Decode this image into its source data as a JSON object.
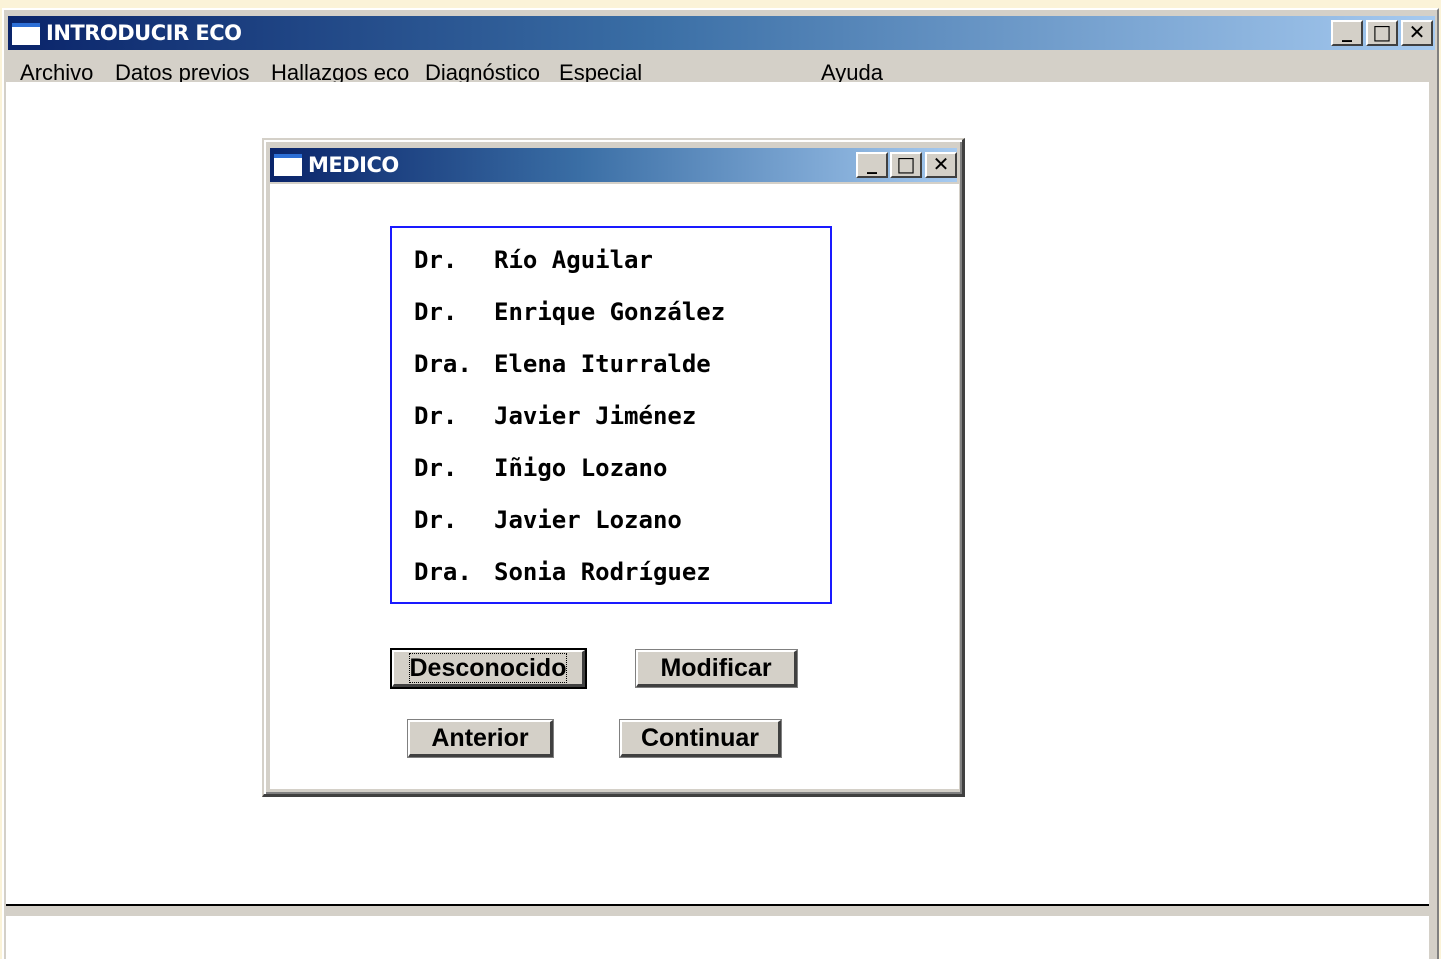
{
  "main_window": {
    "title": "INTRODUCIR ECO",
    "controls": {
      "minimize": "_",
      "maximize": "□",
      "close": "✕"
    }
  },
  "menu": {
    "items": [
      {
        "pre": "",
        "accel": "A",
        "post": "rchivo"
      },
      {
        "pre": "Datos ",
        "accel": "p",
        "post": "revios"
      },
      {
        "pre": "",
        "accel": "H",
        "post": "allazgos eco"
      },
      {
        "pre": "",
        "accel": "D",
        "post": "iagnóstico"
      },
      {
        "pre": "",
        "accel": "E",
        "post": "special"
      },
      {
        "pre": "Ay",
        "accel": "u",
        "post": "da"
      }
    ]
  },
  "dialog": {
    "title": "MEDICO",
    "controls": {
      "minimize": "_",
      "maximize": "□",
      "close": "✕"
    },
    "doctors": [
      {
        "title": "Dr.",
        "name": "Río Aguilar"
      },
      {
        "title": "Dr.",
        "name": "Enrique González"
      },
      {
        "title": "Dra.",
        "name": "Elena Iturralde"
      },
      {
        "title": "Dr.",
        "name": "Javier Jiménez"
      },
      {
        "title": "Dr.",
        "name": "Iñigo Lozano"
      },
      {
        "title": "Dr.",
        "name": "Javier Lozano"
      },
      {
        "title": "Dra.",
        "name": "Sonia Rodríguez"
      }
    ],
    "buttons": {
      "unknown": "Desconocido",
      "modify": "Modificar",
      "previous": "Anterior",
      "continue": "Continuar"
    },
    "focused_button": "Desconocido"
  },
  "icons": {
    "app_icon": "window-icon",
    "minimize": "minimize-icon",
    "maximize": "maximize-icon",
    "close": "close-icon"
  },
  "colors": {
    "titlebar_start": "#0a246a",
    "titlebar_end": "#a6caf0",
    "list_border": "#1a1aff",
    "face": "#d4d0c8"
  }
}
